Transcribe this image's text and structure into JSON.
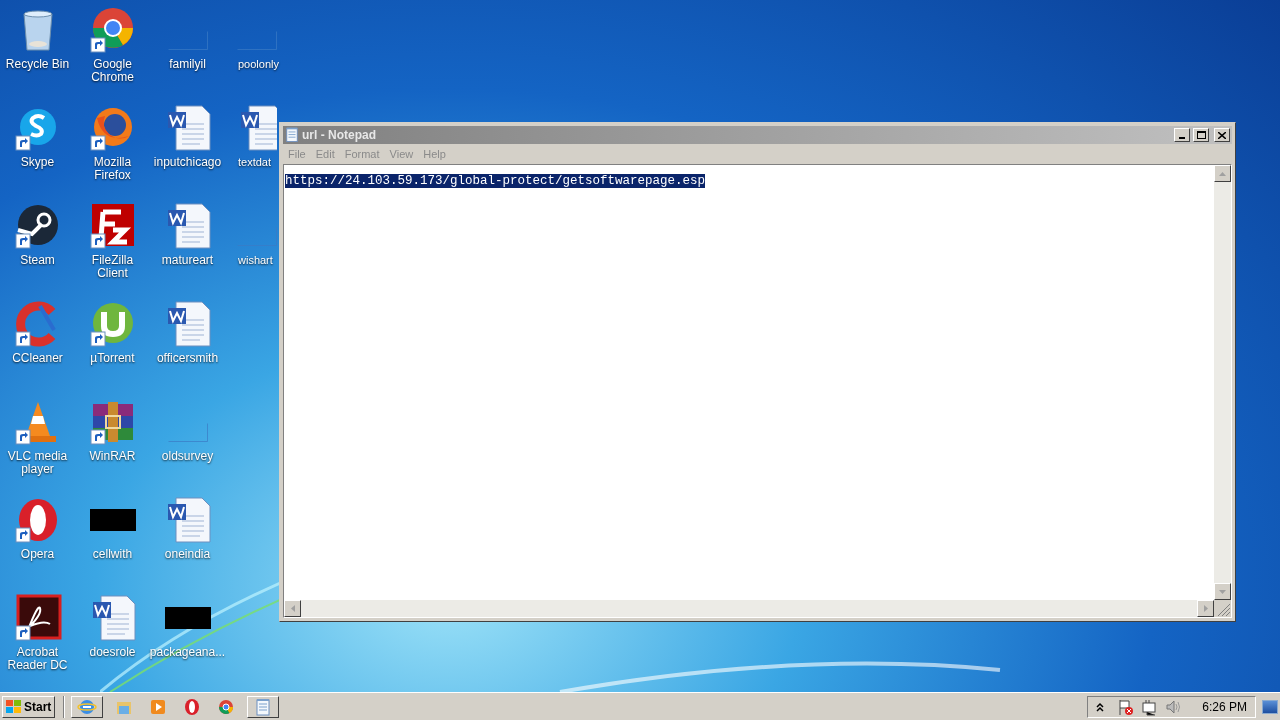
{
  "desktop": {
    "icons": [
      {
        "label": "Recycle Bin",
        "kind": "recycle",
        "shortcut": false
      },
      {
        "label": "Skype",
        "kind": "skype",
        "shortcut": true
      },
      {
        "label": "Steam",
        "kind": "steam",
        "shortcut": true
      },
      {
        "label": "CCleaner",
        "kind": "ccleaner",
        "shortcut": true
      },
      {
        "label": "VLC media player",
        "kind": "vlc",
        "shortcut": true
      },
      {
        "label": "Opera",
        "kind": "opera",
        "shortcut": true
      },
      {
        "label": "Acrobat Reader DC",
        "kind": "acrobat",
        "shortcut": true
      },
      {
        "label": "Google Chrome",
        "kind": "chrome",
        "shortcut": true
      },
      {
        "label": "Mozilla Firefox",
        "kind": "firefox",
        "shortcut": true
      },
      {
        "label": "FileZilla Client",
        "kind": "filezilla",
        "shortcut": true
      },
      {
        "label": "µTorrent",
        "kind": "utorrent",
        "shortcut": true
      },
      {
        "label": "WinRAR",
        "kind": "winrar",
        "shortcut": true
      },
      {
        "label": "cellwith",
        "kind": "redacted",
        "shortcut": false
      },
      {
        "label": "doesrole",
        "kind": "word",
        "shortcut": false
      },
      {
        "label": "familyil",
        "kind": "blank",
        "shortcut": false
      },
      {
        "label": "inputchicago",
        "kind": "word",
        "shortcut": false
      },
      {
        "label": "matureart",
        "kind": "word",
        "shortcut": false
      },
      {
        "label": "officersmith",
        "kind": "word",
        "shortcut": false
      },
      {
        "label": "oldsurvey",
        "kind": "blank",
        "shortcut": false
      },
      {
        "label": "oneindia",
        "kind": "word",
        "shortcut": false
      },
      {
        "label": "packageana...",
        "kind": "redacted",
        "shortcut": false
      },
      {
        "label": "poolonly",
        "kind": "blank",
        "shortcut": false
      },
      {
        "label": "textdat",
        "kind": "word",
        "shortcut": false
      },
      {
        "label": "wishart",
        "kind": "blank",
        "shortcut": false
      }
    ]
  },
  "window": {
    "title": "url - Notepad",
    "menu": [
      "File",
      "Edit",
      "Format",
      "View",
      "Help"
    ],
    "text": "https://24.103.59.173/global-protect/getsoftwarepage.esp",
    "text_selected": true
  },
  "taskbar": {
    "start": "Start",
    "apps": [
      {
        "kind": "ie",
        "framed": true
      },
      {
        "kind": "explorer",
        "framed": false
      },
      {
        "kind": "mediaplayer",
        "framed": false
      },
      {
        "kind": "opera",
        "framed": false
      },
      {
        "kind": "chrome",
        "framed": false
      },
      {
        "kind": "notepad",
        "framed": true
      }
    ],
    "tray": [
      {
        "kind": "caret"
      },
      {
        "kind": "flag"
      },
      {
        "kind": "network"
      },
      {
        "kind": "speaker"
      }
    ],
    "clock": "6:26 PM"
  }
}
